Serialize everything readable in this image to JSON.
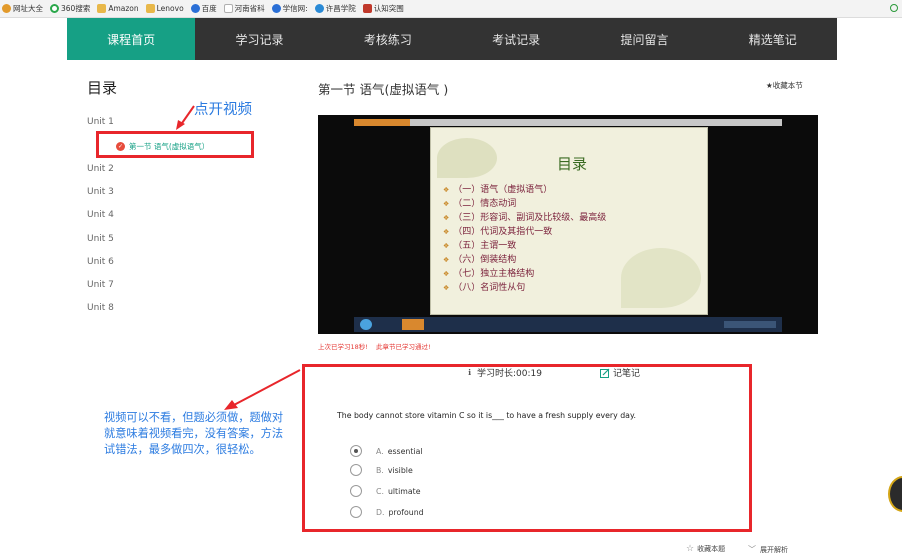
{
  "bookmarks": [
    {
      "label": "网址大全",
      "icon": "star-icon",
      "color": "#e29a2b"
    },
    {
      "label": "360搜索",
      "icon": "search-icon",
      "color": "#2aa74a"
    },
    {
      "label": "Amazon",
      "icon": "folder-icon",
      "color": "#e8b84a"
    },
    {
      "label": "Lenovo",
      "icon": "folder-icon",
      "color": "#e8b84a"
    },
    {
      "label": "百度",
      "icon": "paw-icon",
      "color": "#2a6fd6"
    },
    {
      "label": "河南省科",
      "icon": "page-icon",
      "color": "#b0b0b0"
    },
    {
      "label": "学信网:",
      "icon": "paw-icon",
      "color": "#2a6fd6"
    },
    {
      "label": "许昌学院",
      "icon": "globe-icon",
      "color": "#2a8ad6"
    },
    {
      "label": "认知突围",
      "icon": "app-icon",
      "color": "#c0392b"
    }
  ],
  "nav": {
    "tabs": [
      {
        "label": "课程首页",
        "active": true
      },
      {
        "label": "学习记录",
        "active": false
      },
      {
        "label": "考核练习",
        "active": false
      },
      {
        "label": "考试记录",
        "active": false
      },
      {
        "label": "提问留言",
        "active": false
      },
      {
        "label": "精选笔记",
        "active": false
      }
    ],
    "active_color": "#16a085"
  },
  "toc": {
    "title": "目录",
    "units": [
      "Unit 1",
      "Unit 2",
      "Unit 3",
      "Unit 4",
      "Unit 5",
      "Unit 6",
      "Unit 7",
      "Unit 8"
    ],
    "current_lesson": "第一节 语气(虚拟语气）"
  },
  "annotations": {
    "open_video": "点开视频",
    "tip": "视频可以不看，但题必须做，题做对就意味着视频看完，没有答案，方法试错法，最多做四次，很轻松。",
    "color": "#2b7be0",
    "highlight_color": "#e8262b"
  },
  "lesson": {
    "title": "第一节 语气(虚拟语气 )",
    "favorite_label": "★收藏本节"
  },
  "video": {
    "slide_title": "目录",
    "items": [
      "（一）语气（虚拟语气）",
      "（二）情态动词",
      "（三）形容词、副词及比较级、最高级",
      "（四）代词及其指代一致",
      "（五）主谓一致",
      "（六）倒装结构",
      "（七）独立主格结构",
      "（八）名词性从句"
    ]
  },
  "status": {
    "last_study": "上次已学习18秒!",
    "passed": "此章节已学习通过!"
  },
  "quiz": {
    "timer_label": "学习时长:00:19",
    "note_label": "记笔记",
    "question": "The body cannot store vitamin C so it is___ to have a fresh supply every day.",
    "options": [
      {
        "letter": "A.",
        "text": "essential",
        "checked": true
      },
      {
        "letter": "B.",
        "text": "visible",
        "checked": false
      },
      {
        "letter": "C.",
        "text": "ultimate",
        "checked": false
      },
      {
        "letter": "D.",
        "text": "profound",
        "checked": false
      }
    ]
  },
  "footer": {
    "collect_question": "收藏本题",
    "expand_analysis": "展开解析"
  }
}
